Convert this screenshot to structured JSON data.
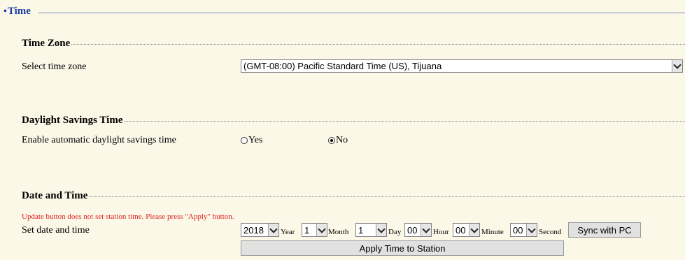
{
  "section": {
    "title": "Time"
  },
  "time_zone": {
    "heading": "Time Zone",
    "label": "Select time zone",
    "value": "(GMT-08:00) Pacific Standard Time (US), Tijuana"
  },
  "dst": {
    "heading": "Daylight Savings Time",
    "label": "Enable automatic daylight savings time",
    "options": [
      "Yes",
      "No"
    ],
    "selected": "No"
  },
  "date_time": {
    "heading": "Date and Time",
    "warning": "Update button does not set station time. Please press \"Apply\" button.",
    "label": "Set date and time",
    "year": {
      "value": "2018",
      "unit": "Year"
    },
    "month": {
      "value": "1",
      "unit": "Month"
    },
    "day": {
      "value": "1",
      "unit": "Day"
    },
    "hour": {
      "value": "00",
      "unit": "Hour"
    },
    "minute": {
      "value": "00",
      "unit": "Minute"
    },
    "second": {
      "value": "00",
      "unit": "Second"
    },
    "sync_button": "Sync with PC",
    "apply_button": "Apply Time to Station"
  }
}
